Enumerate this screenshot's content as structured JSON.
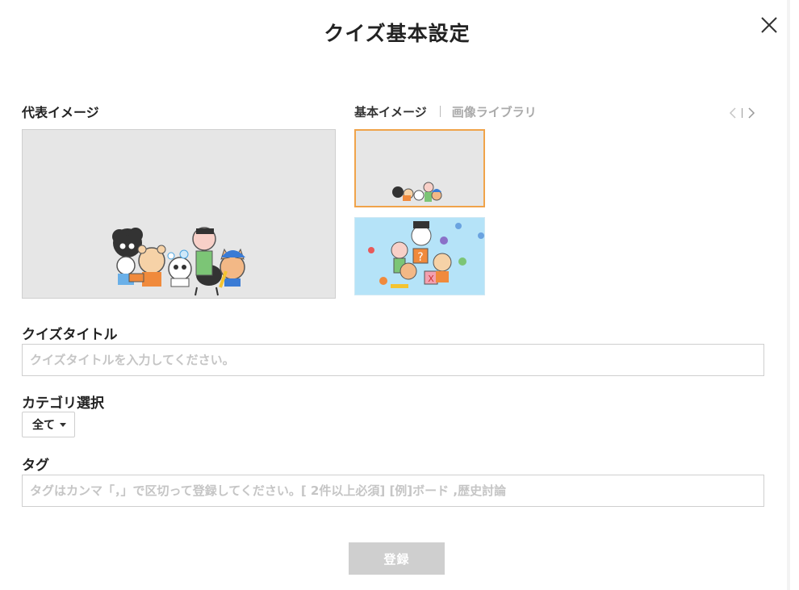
{
  "dialog": {
    "title": "クイズ基本設定",
    "close_icon": "close-icon"
  },
  "representative_image": {
    "label": "代表イメージ"
  },
  "image_tabs": {
    "basic": "基本イメージ",
    "library": "画像ライブラリ",
    "selected": "basic"
  },
  "thumbnails": [
    {
      "background": "#e6e6e6",
      "selected": true
    },
    {
      "background": "#b5e3f8",
      "selected": false
    }
  ],
  "quiz_title": {
    "label": "クイズタイトル",
    "placeholder": "クイズタイトルを入力してください。",
    "value": ""
  },
  "category": {
    "label": "カテゴリ選択",
    "selected": "全て"
  },
  "tags": {
    "label": "タグ",
    "placeholder": "タグはカンマ「，」で区切って登録してください。[ 2件以上必須] [例]ボード ,歴史討論",
    "value": ""
  },
  "submit": {
    "label": "登録",
    "color": "#cfcfcf"
  },
  "colors": {
    "selected_border": "#f0a34a",
    "preview_bg": "#e6e6e6"
  }
}
